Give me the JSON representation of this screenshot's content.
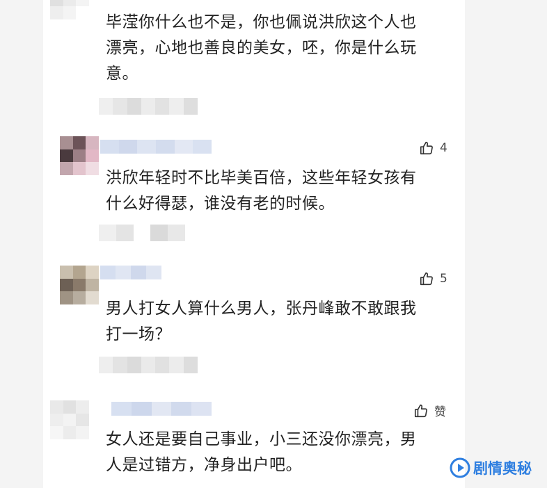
{
  "comments": [
    {
      "text": "毕滢你什么也不是，你也佩说洪欣这个人也\n漂亮，心地也善良的美女，呸，你是什么玩\n意。",
      "likes": ""
    },
    {
      "text": "洪欣年轻时不比毕美百倍，这些年轻女孩有\n什么好得瑟，谁没有老的时候。",
      "likes": "4"
    },
    {
      "text": "男人打女人算什么男人，张丹峰敢不敢跟我\n打一场？",
      "likes": "5"
    },
    {
      "text": "女人还是要自己事业，小三还没你漂亮，男\n人是过错方，净身出户吧。",
      "likes": "赞"
    }
  ],
  "watermark": {
    "label": "剧情奥秘"
  },
  "colors": {
    "accent": "#2f7fe0",
    "text": "#222222",
    "card": "#ffffff"
  }
}
